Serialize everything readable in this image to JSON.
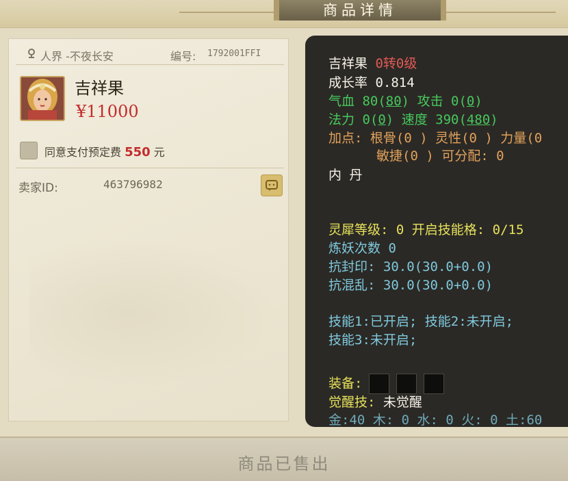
{
  "header": {
    "title": "商品详情"
  },
  "item": {
    "location": "人界 -不夜长安",
    "id_label": "编号:",
    "id_value": "1792001FFI",
    "name": "吉祥果",
    "price": "¥11000",
    "agreement_text": "同意支付预定费",
    "agreement_amount": "550",
    "agreement_unit": "元",
    "seller_label": "卖家ID:",
    "seller_id": "463796982"
  },
  "stats": {
    "pet_name": "吉祥果",
    "level": "0转0级",
    "growth": "成长率 0.814",
    "hp_label": "气血 80",
    "hp_max": "80",
    "atk_label": "攻击 0",
    "atk_max": "0",
    "mp_label": "法力 0",
    "mp_max": "0",
    "speed_label": "速度 390",
    "speed_max": "480",
    "points_line1": "加点: 根骨(0 ) 灵性(0 ) 力量(0",
    "points_line2": "敏捷(0 ) 可分配: 0",
    "neidan": "内 丹",
    "lingxi": "灵犀等级: 0 开启技能格: 0/15",
    "lianyao": "炼妖次数 0",
    "resist_seal": "抗封印: 30.0(30.0+0.0)",
    "resist_chaos": "抗混乱: 30.0(30.0+0.0)",
    "skills_line1": "技能1:已开启; 技能2:未开启;",
    "skills_line2": "技能3:未开启;",
    "equip_label": "装备:",
    "awaken_label": "觉醒技:",
    "awaken_value": "未觉醒",
    "elements": "金:40 木: 0 水: 0 火: 0 土:60"
  },
  "footer": {
    "status": "商品已售出"
  },
  "colors": {
    "price": "#c32c2c",
    "panel": "#2b2925",
    "green": "#47c95e",
    "yellow": "#e6e25c",
    "cyan": "#7fc9de"
  },
  "icons": [
    "location-pin-icon",
    "chat-icon"
  ]
}
